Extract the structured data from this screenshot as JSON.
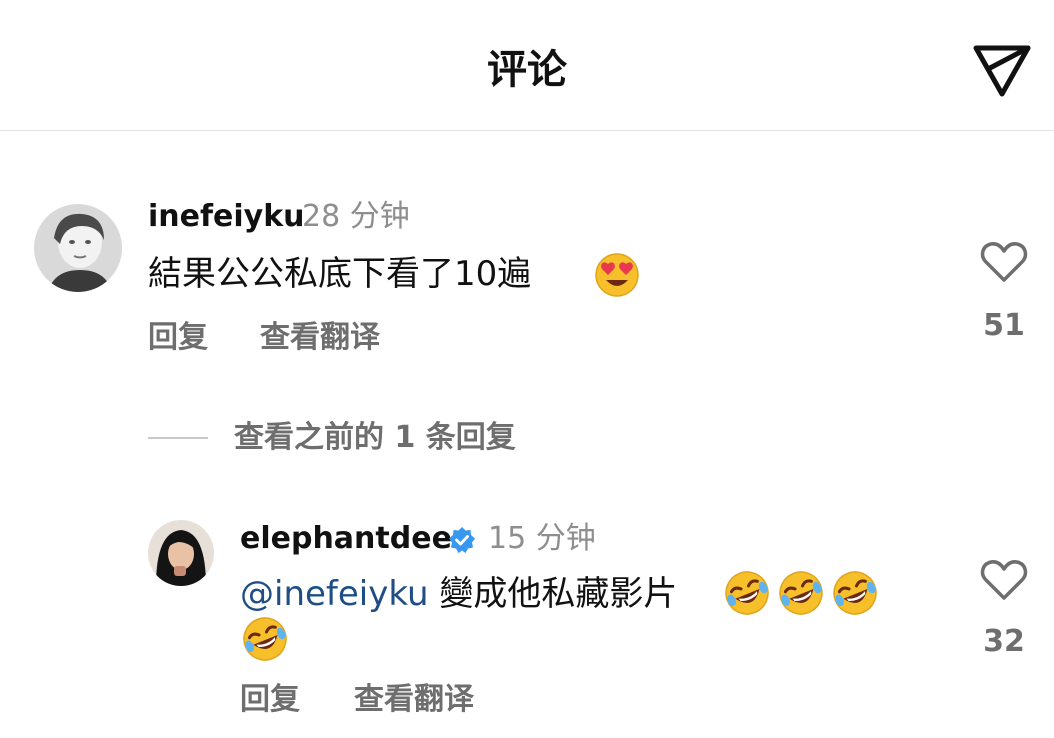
{
  "header": {
    "title": "评论",
    "send_icon": "send-icon"
  },
  "comments": [
    {
      "username": "inefeiyku",
      "time": "28 分钟",
      "text": "結果公公私底下看了10遍",
      "emoji": [
        "heart-eyes-face"
      ],
      "actions": {
        "reply": "回复",
        "translate": "查看翻译"
      },
      "likes": "51"
    }
  ],
  "replies_toggle": {
    "label": "查看之前的 1 条回复"
  },
  "replies": [
    {
      "username": "elephantdee",
      "verified": true,
      "time": "15 分钟",
      "mention": "@inefeiyku",
      "text": " 變成他私藏影片",
      "emoji": [
        "rolling-on-floor-laughing-face",
        "rolling-on-floor-laughing-face",
        "rolling-on-floor-laughing-face",
        "rolling-on-floor-laughing-face"
      ],
      "actions": {
        "reply": "回复",
        "translate": "查看翻译"
      },
      "likes": "32"
    }
  ],
  "colors": {
    "username": "#111111",
    "secondary": "#8e8e8e",
    "action": "#6e6e6e",
    "mention": "#1f4e86",
    "verified": "#3897f0",
    "divider": "#e3e3e3"
  }
}
